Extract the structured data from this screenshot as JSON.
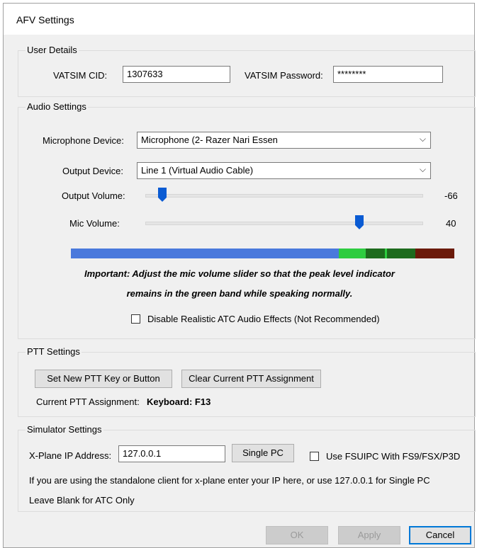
{
  "window": {
    "title": "AFV Settings"
  },
  "user_details": {
    "group_label": "User Details",
    "cid_label": "VATSIM CID:",
    "cid_value": "1307633",
    "password_label": "VATSIM Password:",
    "password_value": "********"
  },
  "audio_settings": {
    "group_label": "Audio Settings",
    "mic_device_label": "Microphone Device:",
    "mic_device_value": "Microphone (2- Razer Nari Essen",
    "output_device_label": "Output Device:",
    "output_device_value": "Line 1 (Virtual Audio Cable)",
    "output_volume_label": "Output Volume:",
    "output_volume_value": "-66",
    "output_volume_fraction": 0.06,
    "mic_volume_label": "Mic Volume:",
    "mic_volume_value": "40",
    "mic_volume_fraction": 0.77,
    "meter_colors": {
      "level": "#4a79dc",
      "green": "#2ecc40",
      "dark_green": "#1e6b1e",
      "red": "#6b1a0a"
    },
    "important_line1": "Important: Adjust the mic volume slider so that the peak level indicator",
    "important_line2": "remains in the green band while speaking normally.",
    "disable_effects_label": "Disable Realistic ATC Audio Effects (Not Recommended)",
    "disable_effects_checked": false
  },
  "ptt_settings": {
    "group_label": "PTT Settings",
    "set_button": "Set New PTT Key or Button",
    "clear_button": "Clear Current PTT Assignment",
    "current_label": "Current PTT Assignment:",
    "current_value": "Keyboard: F13"
  },
  "simulator_settings": {
    "group_label": "Simulator Settings",
    "xplane_ip_label": "X-Plane IP Address:",
    "xplane_ip_value": "127.0.0.1",
    "single_pc_button": "Single PC",
    "fsuipc_label": "Use FSUIPC With FS9/FSX/P3D",
    "fsuipc_checked": false,
    "help_line1": "If you are using the standalone client for x-plane enter your IP here, or use 127.0.0.1 for Single PC",
    "help_line2": "Leave Blank for ATC Only"
  },
  "footer": {
    "ok_label": "OK",
    "apply_label": "Apply",
    "cancel_label": "Cancel"
  }
}
